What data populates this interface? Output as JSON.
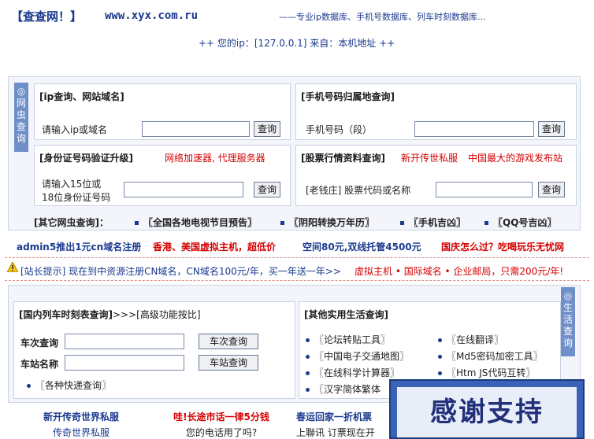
{
  "header": {
    "brand": "【查查网！】",
    "domain": "www.xyx.com.ru",
    "tagline": "——专业ip数据库、手机号数据库、列车时刻数据库...",
    "ip_line": "++ 您的ip：[127.0.0.1] 来自：本机地址 ++"
  },
  "top_panel": {
    "vtab": "◎网虫查询",
    "ip_box": {
      "title": "[ip查询、网站域名]",
      "label": "请输入ip或域名",
      "button": "查询",
      "value": ""
    },
    "phone_box": {
      "title": "[手机号码归属地查询]",
      "label": "手机号码（段）",
      "button": "查询",
      "value": ""
    },
    "id_box": {
      "title": "[身份证号码验证升级]",
      "ad": "网络加速器, 代理服务器",
      "label1": "请输入15位或",
      "label2": "18位身份证号码",
      "button": "查询",
      "value": ""
    },
    "stock_box": {
      "title": "[股票行情资料查询]",
      "ad1": "新开传世私服",
      "ad2": "中国最大的游戏发布站",
      "label": "[老钱庄] 股票代码或名称",
      "button": "查询",
      "value": ""
    },
    "other_title": "[其它网虫查询]：",
    "other_links": [
      "〖全国各地电视节目预告〗",
      "〖阴阳转换万年历〗",
      "〖手机吉凶〗",
      "〖QQ号吉凶〗"
    ]
  },
  "ads_row1": [
    "admin5推出1元cn域名注册",
    "香港、美国虚拟主机，超低价",
    "空间80元,双线托管4500元",
    "国庆怎么过？吃喝玩乐无忧网"
  ],
  "notice": {
    "text": "[站长提示] 现在到中资源注册CN域名，CN域名100元/年，买一年送一年>>",
    "ad": "虚拟主机 • 国际域名 • 企业邮局，只需200元/年!"
  },
  "bottom_panel": {
    "vtab": "◎生活查询",
    "train_box": {
      "title": "[国内列车时刻表查询]",
      "advanced": ">>>[高级功能按比]",
      "label_train": "车次查询",
      "btn_train": "车次查询",
      "label_station": "车站名称",
      "btn_station": "车站查询",
      "express": "〖各种快递查询〗"
    },
    "life_box": {
      "title": "[其他实用生活查询]",
      "left_links": [
        "〖论坛转贴工具〗",
        "〖中国电子交通地图〗",
        "〖在线科学计算器〗",
        "〖汉字简体繁体"
      ],
      "right_links": [
        "〖在线翻译〗",
        "〖Md5密码加密工具〗",
        "〖Htm JS代码互转〗"
      ]
    }
  },
  "footer": [
    {
      "title": "新开传奇世界私服",
      "sub": "传奇世界私服"
    },
    {
      "title": "哇!长途市话一律5分钱",
      "sub": "您的电话用了吗?"
    },
    {
      "title": "春运回家一折机票",
      "sub": "上聯讯 订票现在开"
    }
  ],
  "overlay": {
    "text": "感谢支持"
  }
}
